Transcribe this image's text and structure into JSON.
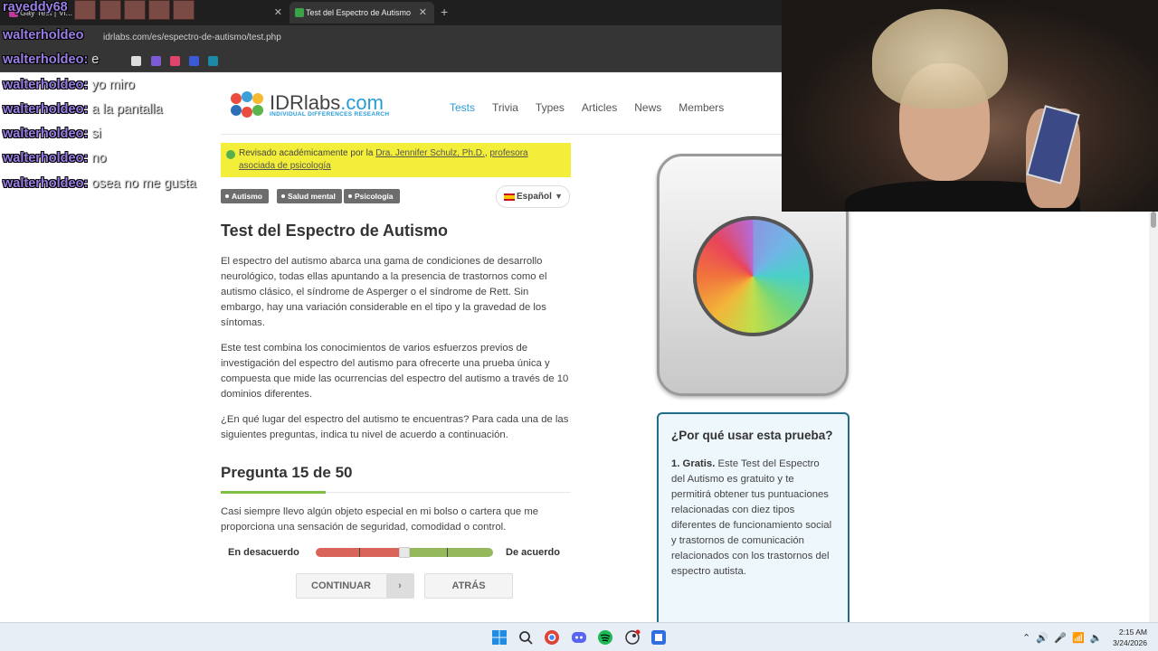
{
  "browser": {
    "tabs": [
      {
        "label": "Gay Test | Vi...",
        "active": false
      },
      {
        "label": "Test del Espectro de Autismo",
        "active": true
      }
    ],
    "url": "idrlabs.com/es/espectro-de-autismo/test.php"
  },
  "chat_overlay": [
    {
      "user": "rayeddy68",
      "message": ""
    },
    {
      "user": "walterholdeo",
      "message": ""
    },
    {
      "user": "walterholdeo",
      "message": "e"
    },
    {
      "user": "walterholdeo",
      "message": "yo miro"
    },
    {
      "user": "walterholdeo",
      "message": "a la pantalla"
    },
    {
      "user": "walterholdeo",
      "message": "si"
    },
    {
      "user": "walterholdeo",
      "message": "no"
    },
    {
      "user": "walterholdeo",
      "message": "osea no me gusta"
    }
  ],
  "site": {
    "logo": {
      "name": "IDRlabs",
      "domain": ".com",
      "tagline": "INDIVIDUAL DIFFERENCES RESEARCH"
    },
    "nav": [
      "Tests",
      "Trivia",
      "Types",
      "Articles",
      "News",
      "Members"
    ],
    "review": {
      "prefix": "Revisado académicamente por la ",
      "reviewer": "Dra. Jennifer Schulz, Ph.D.",
      "sep": ", ",
      "role": "profesora asociada de psicología"
    },
    "tags": [
      "Autismo",
      "Salud mental",
      "Psicología"
    ],
    "language": "Español",
    "title": "Test del Espectro de Autismo",
    "paragraphs": [
      "El espectro del autismo abarca una gama de condiciones de desarrollo neurológico, todas ellas apuntando a la presencia de trastornos como el autismo clásico, el síndrome de Asperger o el síndrome de Rett. Sin embargo, hay una variación considerable en el tipo y la gravedad de los síntomas.",
      "Este test combina los conocimientos de varios esfuerzos previos de investigación del espectro del autismo para ofrecerte una prueba única y compuesta que mide las ocurrencias del espectro del autismo a través de 10 dominios diferentes.",
      "¿En qué lugar del espectro del autismo te encuentras? Para cada una de las siguientes preguntas, indica tu nivel de acuerdo a continuación."
    ],
    "question_header": "Pregunta 15 de 50",
    "progress": 0.3,
    "question_text": "Casi siempre llevo algún objeto especial en mi bolso o cartera que me proporciona una sensación de seguridad, comodidad o control.",
    "scale": {
      "left": "En desacuerdo",
      "right": "De acuerdo",
      "selected": 0.5
    },
    "buttons": {
      "continue": "CONTINUAR",
      "back": "ATRÁS"
    },
    "sidebar": {
      "title": "¿Por qué usar esta prueba?",
      "point_label": "1. Gratis.",
      "point_text": " Este Test del Espectro del Autismo es gratuito y te permitirá obtener tus puntuaciones relacionadas con diez tipos diferentes de funcionamiento social y trastornos de comunicación relacionados con los trastornos del espectro autista."
    }
  },
  "taskbar": {
    "time": "2:15 AM",
    "date": "3/24/2026"
  }
}
